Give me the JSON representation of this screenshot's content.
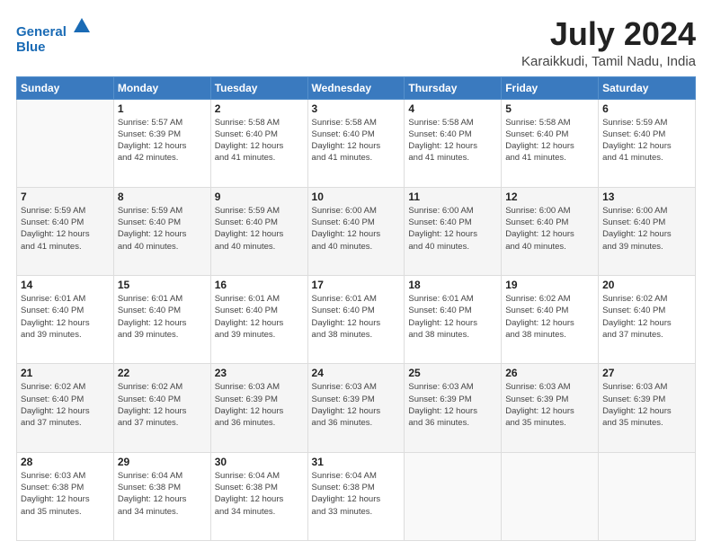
{
  "logo": {
    "line1": "General",
    "line2": "Blue"
  },
  "title": "July 2024",
  "subtitle": "Karaikkudi, Tamil Nadu, India",
  "weekdays": [
    "Sunday",
    "Monday",
    "Tuesday",
    "Wednesday",
    "Thursday",
    "Friday",
    "Saturday"
  ],
  "weeks": [
    [
      {
        "day": "",
        "info": ""
      },
      {
        "day": "1",
        "info": "Sunrise: 5:57 AM\nSunset: 6:39 PM\nDaylight: 12 hours\nand 42 minutes."
      },
      {
        "day": "2",
        "info": "Sunrise: 5:58 AM\nSunset: 6:40 PM\nDaylight: 12 hours\nand 41 minutes."
      },
      {
        "day": "3",
        "info": "Sunrise: 5:58 AM\nSunset: 6:40 PM\nDaylight: 12 hours\nand 41 minutes."
      },
      {
        "day": "4",
        "info": "Sunrise: 5:58 AM\nSunset: 6:40 PM\nDaylight: 12 hours\nand 41 minutes."
      },
      {
        "day": "5",
        "info": "Sunrise: 5:58 AM\nSunset: 6:40 PM\nDaylight: 12 hours\nand 41 minutes."
      },
      {
        "day": "6",
        "info": "Sunrise: 5:59 AM\nSunset: 6:40 PM\nDaylight: 12 hours\nand 41 minutes."
      }
    ],
    [
      {
        "day": "7",
        "info": "Sunrise: 5:59 AM\nSunset: 6:40 PM\nDaylight: 12 hours\nand 41 minutes."
      },
      {
        "day": "8",
        "info": "Sunrise: 5:59 AM\nSunset: 6:40 PM\nDaylight: 12 hours\nand 40 minutes."
      },
      {
        "day": "9",
        "info": "Sunrise: 5:59 AM\nSunset: 6:40 PM\nDaylight: 12 hours\nand 40 minutes."
      },
      {
        "day": "10",
        "info": "Sunrise: 6:00 AM\nSunset: 6:40 PM\nDaylight: 12 hours\nand 40 minutes."
      },
      {
        "day": "11",
        "info": "Sunrise: 6:00 AM\nSunset: 6:40 PM\nDaylight: 12 hours\nand 40 minutes."
      },
      {
        "day": "12",
        "info": "Sunrise: 6:00 AM\nSunset: 6:40 PM\nDaylight: 12 hours\nand 40 minutes."
      },
      {
        "day": "13",
        "info": "Sunrise: 6:00 AM\nSunset: 6:40 PM\nDaylight: 12 hours\nand 39 minutes."
      }
    ],
    [
      {
        "day": "14",
        "info": "Sunrise: 6:01 AM\nSunset: 6:40 PM\nDaylight: 12 hours\nand 39 minutes."
      },
      {
        "day": "15",
        "info": "Sunrise: 6:01 AM\nSunset: 6:40 PM\nDaylight: 12 hours\nand 39 minutes."
      },
      {
        "day": "16",
        "info": "Sunrise: 6:01 AM\nSunset: 6:40 PM\nDaylight: 12 hours\nand 39 minutes."
      },
      {
        "day": "17",
        "info": "Sunrise: 6:01 AM\nSunset: 6:40 PM\nDaylight: 12 hours\nand 38 minutes."
      },
      {
        "day": "18",
        "info": "Sunrise: 6:01 AM\nSunset: 6:40 PM\nDaylight: 12 hours\nand 38 minutes."
      },
      {
        "day": "19",
        "info": "Sunrise: 6:02 AM\nSunset: 6:40 PM\nDaylight: 12 hours\nand 38 minutes."
      },
      {
        "day": "20",
        "info": "Sunrise: 6:02 AM\nSunset: 6:40 PM\nDaylight: 12 hours\nand 37 minutes."
      }
    ],
    [
      {
        "day": "21",
        "info": "Sunrise: 6:02 AM\nSunset: 6:40 PM\nDaylight: 12 hours\nand 37 minutes."
      },
      {
        "day": "22",
        "info": "Sunrise: 6:02 AM\nSunset: 6:40 PM\nDaylight: 12 hours\nand 37 minutes."
      },
      {
        "day": "23",
        "info": "Sunrise: 6:03 AM\nSunset: 6:39 PM\nDaylight: 12 hours\nand 36 minutes."
      },
      {
        "day": "24",
        "info": "Sunrise: 6:03 AM\nSunset: 6:39 PM\nDaylight: 12 hours\nand 36 minutes."
      },
      {
        "day": "25",
        "info": "Sunrise: 6:03 AM\nSunset: 6:39 PM\nDaylight: 12 hours\nand 36 minutes."
      },
      {
        "day": "26",
        "info": "Sunrise: 6:03 AM\nSunset: 6:39 PM\nDaylight: 12 hours\nand 35 minutes."
      },
      {
        "day": "27",
        "info": "Sunrise: 6:03 AM\nSunset: 6:39 PM\nDaylight: 12 hours\nand 35 minutes."
      }
    ],
    [
      {
        "day": "28",
        "info": "Sunrise: 6:03 AM\nSunset: 6:38 PM\nDaylight: 12 hours\nand 35 minutes."
      },
      {
        "day": "29",
        "info": "Sunrise: 6:04 AM\nSunset: 6:38 PM\nDaylight: 12 hours\nand 34 minutes."
      },
      {
        "day": "30",
        "info": "Sunrise: 6:04 AM\nSunset: 6:38 PM\nDaylight: 12 hours\nand 34 minutes."
      },
      {
        "day": "31",
        "info": "Sunrise: 6:04 AM\nSunset: 6:38 PM\nDaylight: 12 hours\nand 33 minutes."
      },
      {
        "day": "",
        "info": ""
      },
      {
        "day": "",
        "info": ""
      },
      {
        "day": "",
        "info": ""
      }
    ]
  ]
}
